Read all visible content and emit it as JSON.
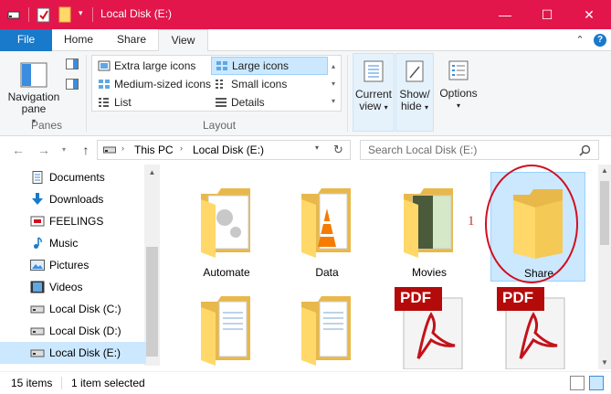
{
  "titlebar": {
    "title": "Local Disk (E:)",
    "minimize": "—",
    "maximize": "☐",
    "close": "✕",
    "bg_color": "#e2164b"
  },
  "tabs": {
    "file": "File",
    "home": "Home",
    "share": "Share",
    "view": "View",
    "help": "?"
  },
  "ribbon": {
    "panes": {
      "nav_pane_line1": "Navigation",
      "nav_pane_line2": "pane",
      "group_label": "Panes"
    },
    "layout": {
      "group_label": "Layout",
      "options": [
        {
          "label": "Extra large icons",
          "selected": false
        },
        {
          "label": "Large icons",
          "selected": true
        },
        {
          "label": "Medium-sized icons",
          "selected": false
        },
        {
          "label": "Small icons",
          "selected": false
        },
        {
          "label": "List",
          "selected": false
        },
        {
          "label": "Details",
          "selected": false
        }
      ]
    },
    "current_view": {
      "line1": "Current",
      "line2": "view"
    },
    "show_hide": {
      "line1": "Show/",
      "line2": "hide"
    },
    "options": {
      "label": "Options"
    }
  },
  "address": {
    "this_pc": "This PC",
    "drive": "Local Disk (E:)",
    "search_placeholder": "Search Local Disk (E:)"
  },
  "sidebar": {
    "items": [
      {
        "label": "Documents",
        "icon": "documents-icon"
      },
      {
        "label": "Downloads",
        "icon": "downloads-icon"
      },
      {
        "label": "FEELINGS",
        "icon": "drive-icon"
      },
      {
        "label": "Music",
        "icon": "music-icon"
      },
      {
        "label": "Pictures",
        "icon": "pictures-icon"
      },
      {
        "label": "Videos",
        "icon": "videos-icon"
      },
      {
        "label": "Local Disk (C:)",
        "icon": "drive-icon"
      },
      {
        "label": "Local Disk (D:)",
        "icon": "drive-icon"
      },
      {
        "label": "Local Disk (E:)",
        "icon": "drive-icon",
        "selected": true
      }
    ]
  },
  "files": [
    {
      "name": "Automate",
      "kind": "folder-with-document"
    },
    {
      "name": "Data",
      "kind": "folder-with-vlc"
    },
    {
      "name": "Movies",
      "kind": "folder-with-image"
    },
    {
      "name": "Share",
      "kind": "folder",
      "selected": true
    },
    {
      "name": "",
      "kind": "folder-with-document"
    },
    {
      "name": "",
      "kind": "folder-with-document"
    },
    {
      "name": "",
      "kind": "pdf"
    },
    {
      "name": "",
      "kind": "pdf"
    }
  ],
  "pdf_label": "PDF",
  "annotation": {
    "number": "1"
  },
  "status": {
    "count": "15 items",
    "selected": "1 item selected"
  }
}
